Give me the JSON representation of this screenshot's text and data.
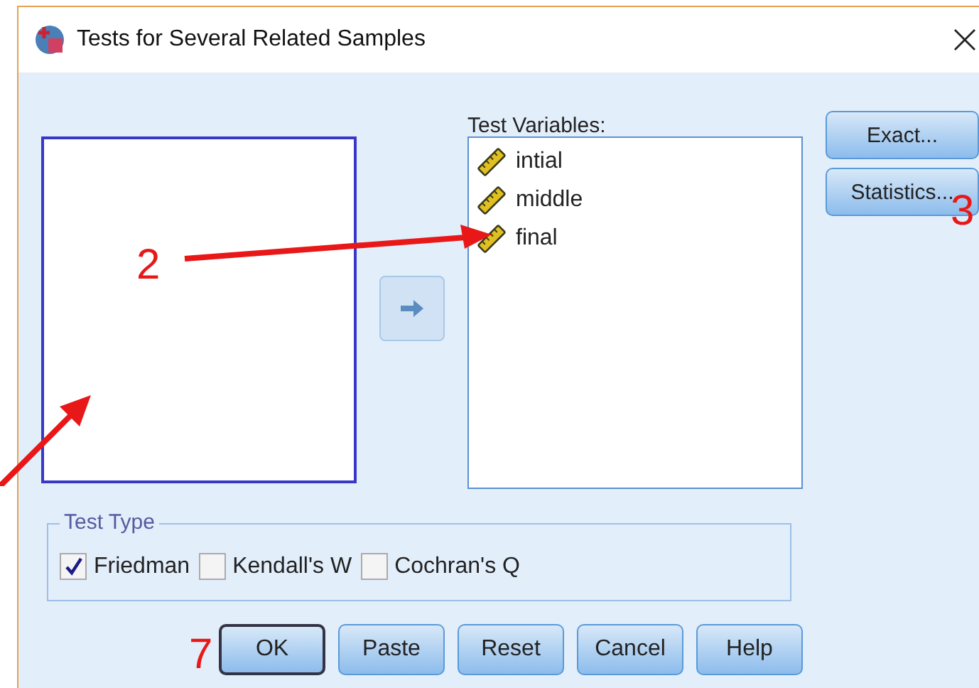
{
  "window": {
    "title": "Tests for Several Related Samples"
  },
  "test_variables": {
    "label": "Test Variables:",
    "items": [
      {
        "name": "intial"
      },
      {
        "name": "middle"
      },
      {
        "name": "final"
      }
    ]
  },
  "side_buttons": [
    "Exact...",
    "Statistics..."
  ],
  "test_type": {
    "title": "Test Type",
    "options": [
      {
        "label": "Friedman",
        "checked": true
      },
      {
        "label": "Kendall's W",
        "checked": false
      },
      {
        "label": "Cochran's Q",
        "checked": false
      }
    ]
  },
  "buttons": [
    {
      "label": "OK",
      "default": true
    },
    {
      "label": "Paste",
      "default": false
    },
    {
      "label": "Reset",
      "default": false
    },
    {
      "label": "Cancel",
      "default": false
    },
    {
      "label": "Help",
      "default": false
    }
  ],
  "annotations": [
    {
      "kind": "arrow",
      "label": "2"
    },
    {
      "kind": "arrow"
    },
    {
      "kind": "number",
      "label": "3"
    },
    {
      "kind": "number",
      "label": "7"
    }
  ]
}
